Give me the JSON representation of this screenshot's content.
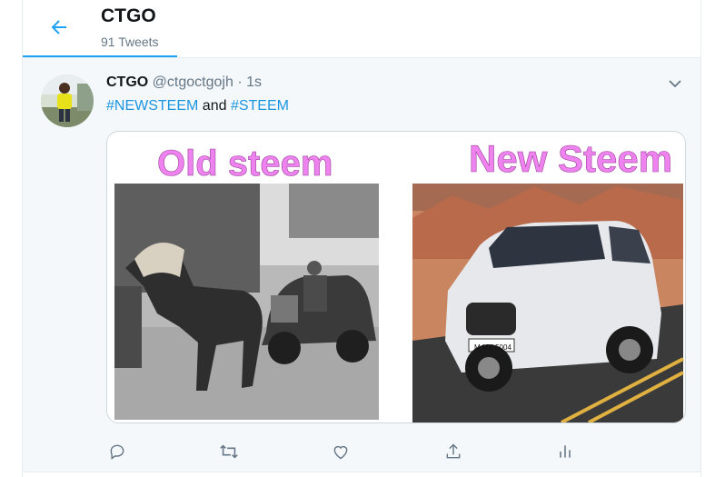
{
  "header": {
    "title": "CTGO",
    "tweet_count": "91 Tweets"
  },
  "tweet": {
    "display_name": "CTGO",
    "handle": "@ctgoctgojh",
    "separator": "·",
    "time": "1s",
    "hashtag_1": "#NEWSTEEM",
    "connector": "and",
    "hashtag_2": "#STEEM",
    "media": {
      "left_label": "Old steem",
      "right_label": "New Steem",
      "right_plate": "M MX 5004"
    }
  },
  "icons": {
    "back": "back-arrow-icon",
    "more": "chevron-down-icon",
    "reply": "reply-icon",
    "retweet": "retweet-icon",
    "like": "heart-icon",
    "share": "share-icon",
    "analytics": "analytics-icon"
  },
  "colors": {
    "accent": "#1da1f2",
    "hashtag": "#1b95e0",
    "muted": "#657786",
    "label_pink": "#ee82ee"
  }
}
